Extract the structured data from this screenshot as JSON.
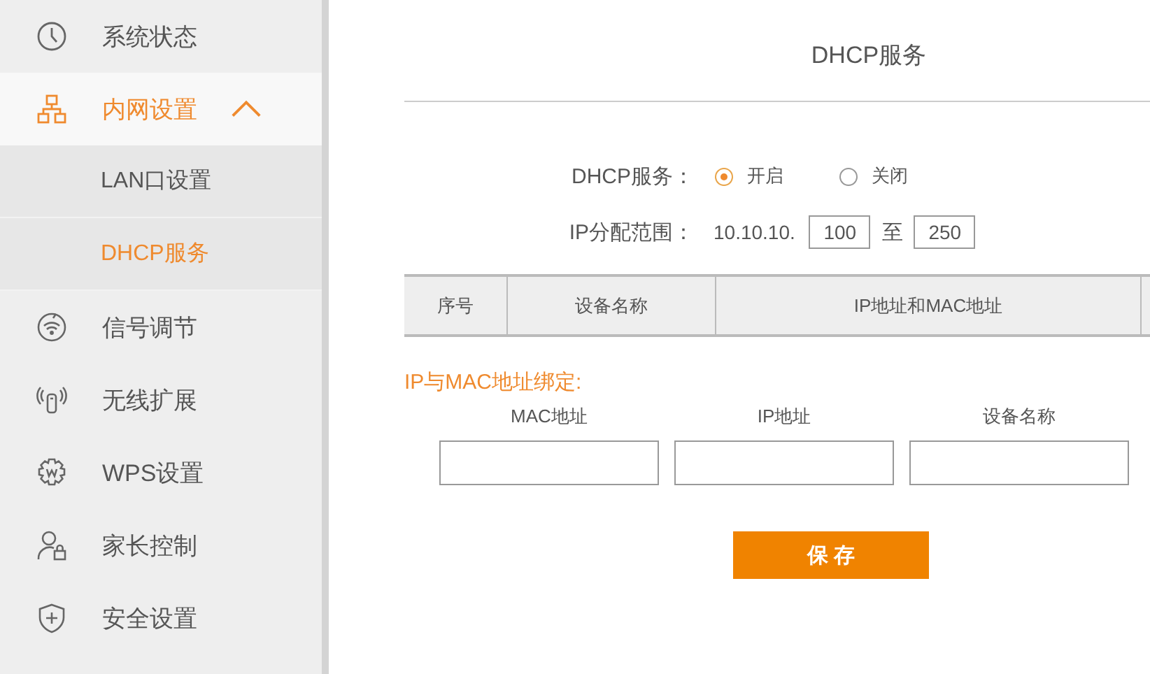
{
  "sidebar": {
    "items": [
      {
        "label": "系统状态",
        "selected": false
      },
      {
        "label": "内网设置",
        "selected": true,
        "expanded": true,
        "children": [
          {
            "label": "LAN口设置",
            "selected": false
          },
          {
            "label": "DHCP服务",
            "selected": true
          }
        ]
      },
      {
        "label": "信号调节",
        "selected": false
      },
      {
        "label": "无线扩展",
        "selected": false
      },
      {
        "label": "WPS设置",
        "selected": false
      },
      {
        "label": "家长控制",
        "selected": false
      },
      {
        "label": "安全设置",
        "selected": false
      }
    ]
  },
  "page_title": "DHCP服务",
  "dhcp_service": {
    "label": "DHCP服务：",
    "options": [
      {
        "label": "开启",
        "selected": true
      },
      {
        "label": "关闭",
        "selected": false
      }
    ]
  },
  "ip_range": {
    "label": "IP分配范围：",
    "prefix": "10.10.10.",
    "start": "100",
    "separator": "至",
    "end": "250"
  },
  "table": {
    "columns": [
      "序号",
      "设备名称",
      "IP地址和MAC地址"
    ]
  },
  "binding": {
    "title": "IP与MAC地址绑定:",
    "fields": [
      {
        "label": "MAC地址"
      },
      {
        "label": "IP地址"
      },
      {
        "label": "设备名称"
      }
    ]
  },
  "save_button": "保 存"
}
